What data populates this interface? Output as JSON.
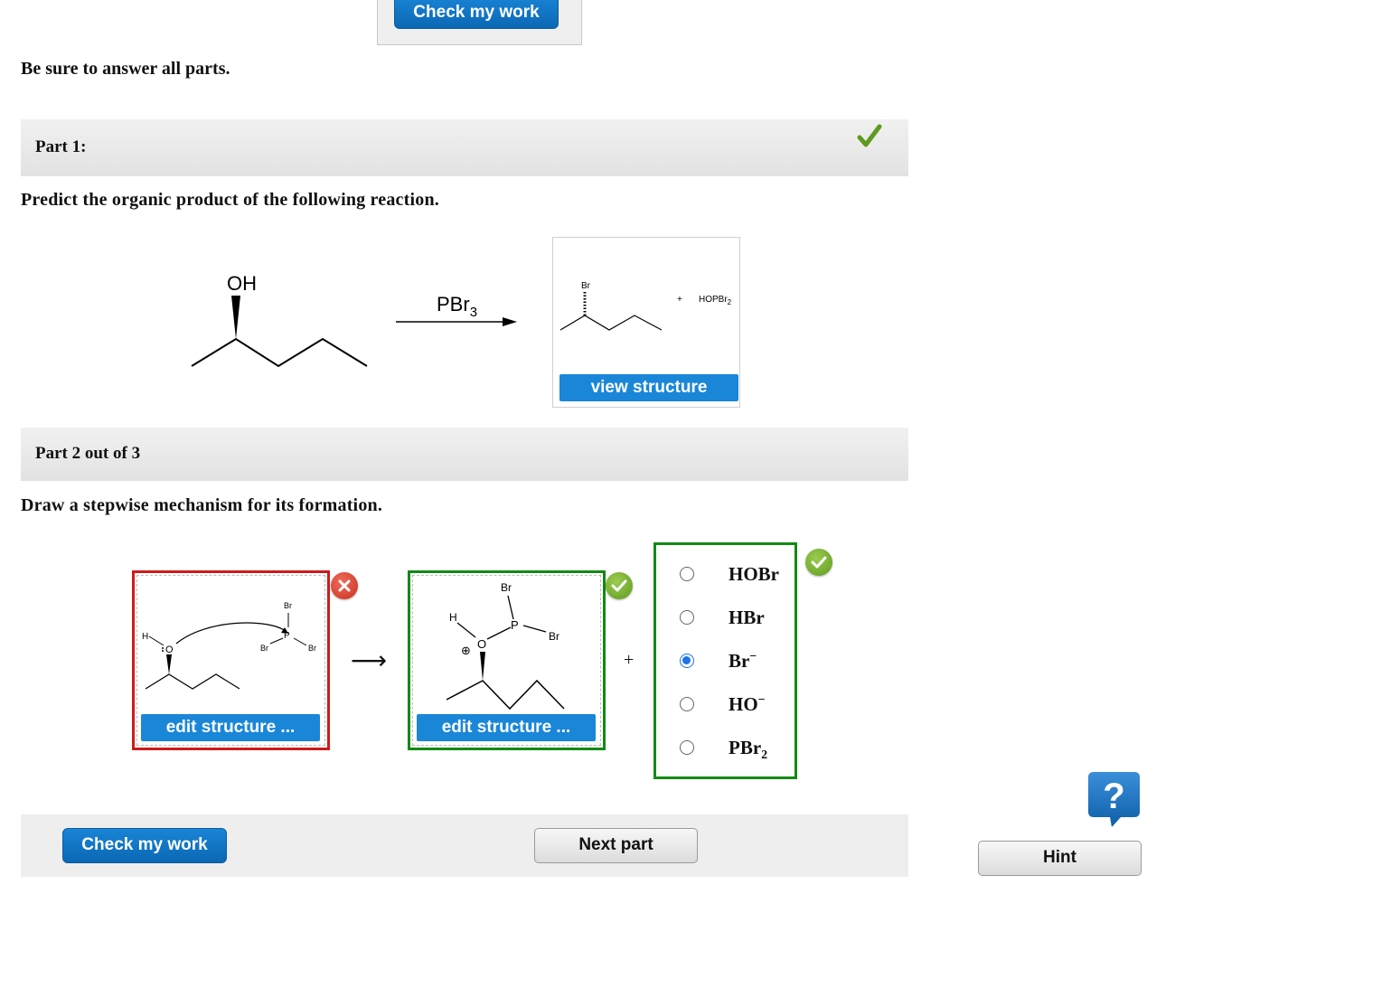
{
  "top": {
    "check_label": "Check my work"
  },
  "instructions": "Be sure to answer all parts.",
  "part1": {
    "title": "Part 1:",
    "prompt": "Predict the organic product of the following reaction.",
    "reactant_label": "OH",
    "reagent": {
      "base": "PBr",
      "sub": "3"
    },
    "product_br": "Br",
    "product_plus": "+",
    "product_side": {
      "base": "HOPBr",
      "sub": "2"
    },
    "view_label": "view structure"
  },
  "part2": {
    "title": "Part 2 out of 3",
    "prompt": "Draw a stepwise mechanism for its formation.",
    "box1": {
      "h": "H",
      "o": "O",
      "p": "P",
      "br_top": "Br",
      "br_left": "Br",
      "br_right": "Br",
      "edit_label": "edit structure ..."
    },
    "box2": {
      "h": "H",
      "o": "O",
      "p": "P",
      "br_top": "Br",
      "br_right": "Br",
      "charge": "⊕",
      "edit_label": "edit structure ..."
    },
    "arrow": "⟶",
    "plus": "+",
    "options": [
      {
        "base": "HOBr",
        "sub": "",
        "sup": "",
        "selected": false
      },
      {
        "base": "HBr",
        "sub": "",
        "sup": "",
        "selected": false
      },
      {
        "base": "Br",
        "sub": "",
        "sup": "−",
        "selected": true
      },
      {
        "base": "HO",
        "sub": "",
        "sup": "−",
        "selected": false
      },
      {
        "base": "PBr",
        "sub": "2",
        "sup": "",
        "selected": false
      }
    ]
  },
  "footer": {
    "check_label": "Check my work",
    "next_label": "Next part"
  },
  "hint": {
    "icon_glyph": "?",
    "label": "Hint"
  },
  "colors": {
    "blue": "#0b6fbf",
    "correct_green": "#138a13",
    "wrong_red": "#d11a1a",
    "check_green": "#5e9a1e"
  }
}
